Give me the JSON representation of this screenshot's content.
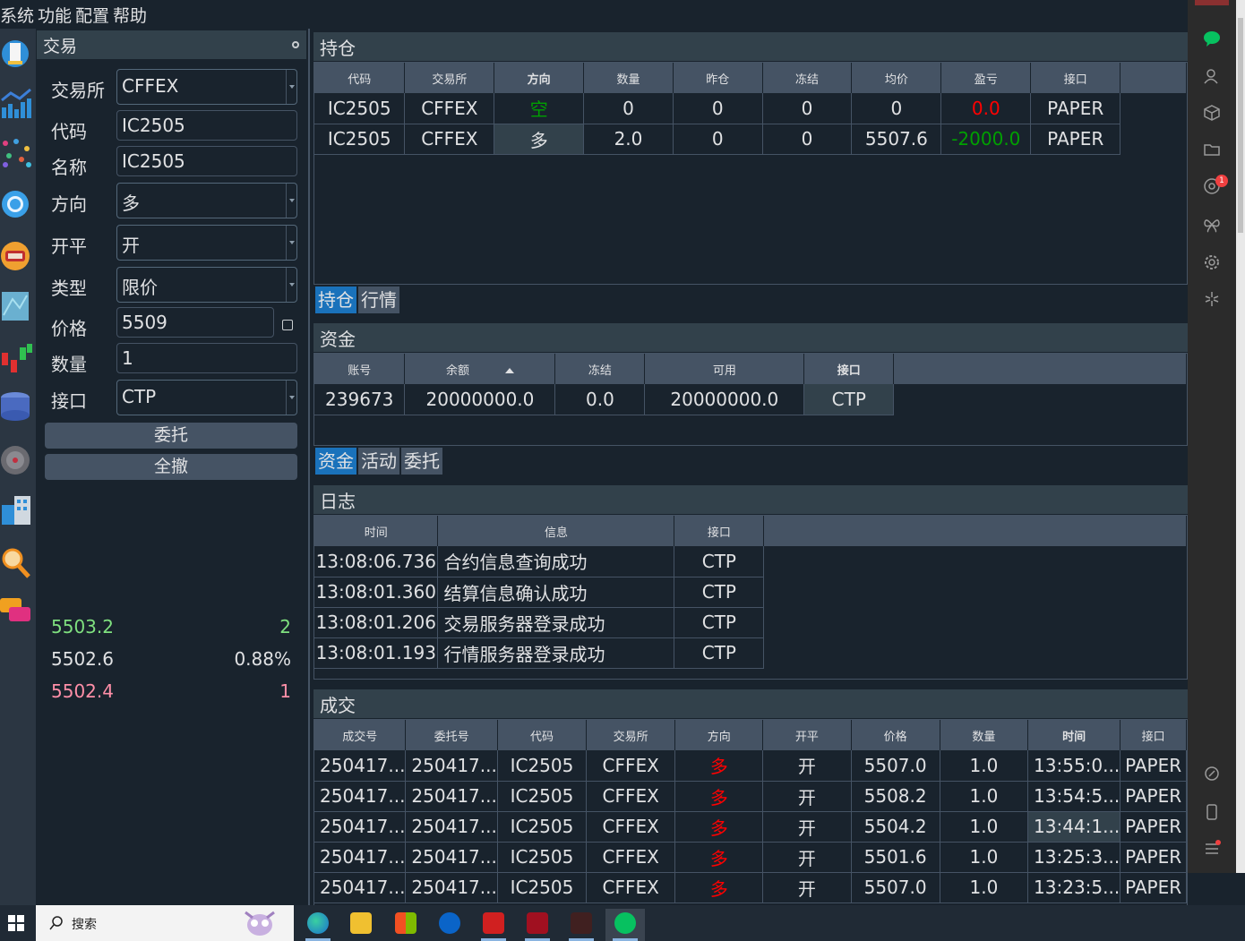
{
  "menu": [
    "系统",
    "功能",
    "配置",
    "帮助"
  ],
  "dock_icons": [
    "chess-rook-icon",
    "bar-chart-icon",
    "scatter-dots-icon",
    "circle-icon",
    "robot-icon",
    "map-icon",
    "candlestick-icon",
    "database-icon",
    "disc-icon",
    "building-calculator-icon",
    "magnifier-icon",
    "chat-bubble-icon"
  ],
  "trade": {
    "title": "交易",
    "exchange": {
      "label": "交易所",
      "value": "CFFEX"
    },
    "symbol": {
      "label": "代码",
      "value": "IC2505"
    },
    "name": {
      "label": "名称",
      "value": "IC2505"
    },
    "direction": {
      "label": "方向",
      "value": "多"
    },
    "offset": {
      "label": "开平",
      "value": "开"
    },
    "order_type": {
      "label": "类型",
      "value": "限价"
    },
    "price": {
      "label": "价格",
      "value": "5509"
    },
    "volume": {
      "label": "数量",
      "value": "1"
    },
    "gateway": {
      "label": "接口",
      "value": "CTP"
    },
    "send_label": "委托",
    "cancel_all_label": "全撤",
    "quotes": [
      {
        "price": "5503.2",
        "vol": "2",
        "color": "#7fe07f"
      },
      {
        "price": "5502.6",
        "vol": "0.88%",
        "color": "#e0e1e3"
      },
      {
        "price": "5502.4",
        "vol": "1",
        "color": "#ff8fa8"
      }
    ]
  },
  "position": {
    "title": "持仓",
    "headers": [
      "代码",
      "交易所",
      "方向",
      "数量",
      "昨仓",
      "冻结",
      "均价",
      "盈亏",
      "接口"
    ],
    "rows": [
      [
        "IC2505",
        "CFFEX",
        "空",
        "0",
        "0",
        "0",
        "0",
        "0.0",
        "PAPER"
      ],
      [
        "IC2505",
        "CFFEX",
        "多",
        "2.0",
        "0",
        "0",
        "5507.6",
        "-2000.0",
        "PAPER"
      ]
    ],
    "tabs": [
      "持仓",
      "行情"
    ]
  },
  "account": {
    "title": "资金",
    "headers": [
      "账号",
      "余额",
      "冻结",
      "可用",
      "接口"
    ],
    "rows": [
      [
        "239673",
        "20000000.0",
        "0.0",
        "20000000.0",
        "CTP"
      ]
    ],
    "tabs": [
      "资金",
      "活动",
      "委托"
    ]
  },
  "log": {
    "title": "日志",
    "headers": [
      "时间",
      "信息",
      "接口"
    ],
    "rows": [
      [
        "13:08:06.736",
        "合约信息查询成功",
        "CTP"
      ],
      [
        "13:08:01.360",
        "结算信息确认成功",
        "CTP"
      ],
      [
        "13:08:01.206",
        "交易服务器登录成功",
        "CTP"
      ],
      [
        "13:08:01.193",
        "行情服务器登录成功",
        "CTP"
      ]
    ]
  },
  "trades": {
    "title": "成交",
    "headers": [
      "成交号",
      "委托号",
      "代码",
      "交易所",
      "方向",
      "开平",
      "价格",
      "数量",
      "时间",
      "接口"
    ],
    "rows": [
      [
        "250417...",
        "250417...",
        "IC2505",
        "CFFEX",
        "多",
        "开",
        "5507.0",
        "1.0",
        "13:55:0...",
        "PAPER"
      ],
      [
        "250417...",
        "250417...",
        "IC2505",
        "CFFEX",
        "多",
        "开",
        "5508.2",
        "1.0",
        "13:54:5...",
        "PAPER"
      ],
      [
        "250417...",
        "250417...",
        "IC2505",
        "CFFEX",
        "多",
        "开",
        "5504.2",
        "1.0",
        "13:44:1...",
        "PAPER"
      ],
      [
        "250417...",
        "250417...",
        "IC2505",
        "CFFEX",
        "多",
        "开",
        "5501.6",
        "1.0",
        "13:25:3...",
        "PAPER"
      ],
      [
        "250417...",
        "250417...",
        "IC2505",
        "CFFEX",
        "多",
        "开",
        "5507.0",
        "1.0",
        "13:23:5...",
        "PAPER"
      ]
    ]
  },
  "right_sidebar": {
    "icons": [
      "chat-icon",
      "contacts-icon",
      "cube-icon",
      "folder-icon",
      "moments-icon",
      "butterfly-icon",
      "settings-icon",
      "sparkle-icon",
      "link-icon",
      "phone-icon",
      "menu-icon"
    ],
    "badge": "1"
  },
  "taskbar": {
    "search_placeholder": "搜索",
    "apps": [
      "edge-icon",
      "file-explorer-icon",
      "store-icon",
      "outlook-icon",
      "red-app-icon",
      "wh6-icon",
      "app-icon",
      "wechat-icon"
    ]
  }
}
